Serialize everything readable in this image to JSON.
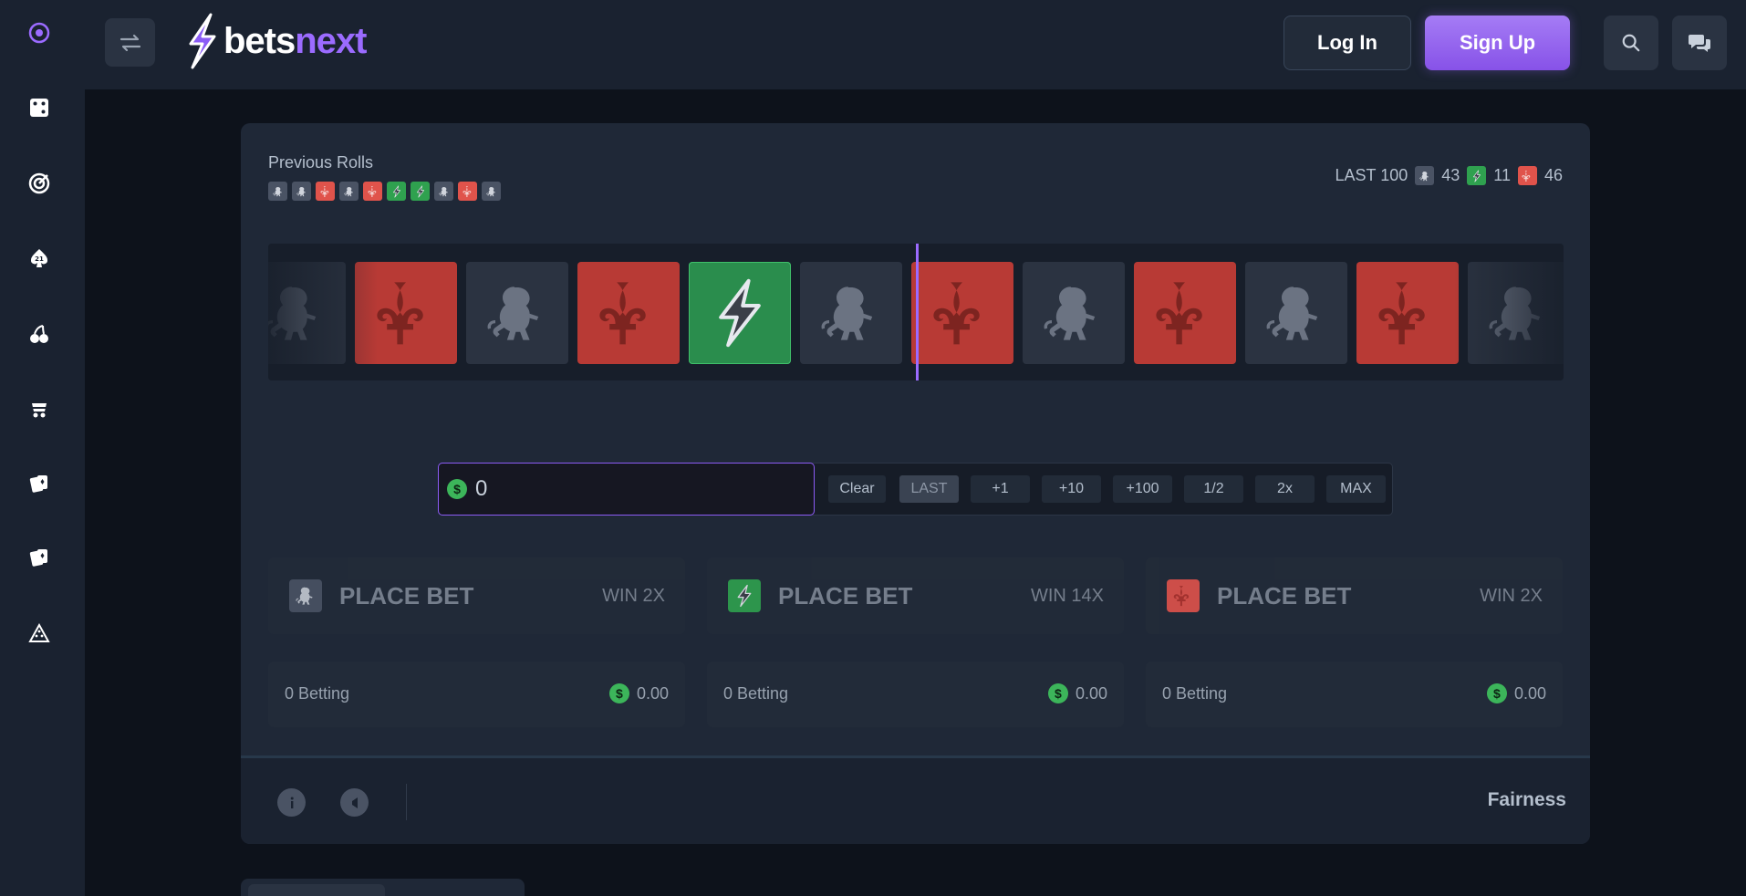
{
  "brand": {
    "bets": "bets",
    "next": "next"
  },
  "header": {
    "login": "Log In",
    "signup": "Sign Up"
  },
  "sidebar": {
    "items": [
      "home-icon",
      "dice-icon",
      "target-icon",
      "blackjack-icon",
      "cherries-icon",
      "mines-cart-icon",
      "cards-icon",
      "cards-alt-icon",
      "plinko-icon"
    ]
  },
  "game": {
    "previous_rolls_title": "Previous Rolls",
    "previous_rolls": [
      "lion",
      "lion",
      "fleur",
      "lion",
      "fleur",
      "bolt",
      "bolt",
      "lion",
      "fleur",
      "lion"
    ],
    "last100": {
      "label": "LAST 100",
      "lion": "43",
      "bolt": "11",
      "fleur": "46"
    },
    "strip": [
      "lion",
      "fleur",
      "lion",
      "fleur",
      "bolt",
      "lion",
      "fleur",
      "lion",
      "fleur",
      "lion",
      "fleur",
      "lion"
    ]
  },
  "bet": {
    "amount": "0",
    "currency_symbol": "$",
    "buttons": [
      "Clear",
      "LAST",
      "+1",
      "+10",
      "+100",
      "1/2",
      "2x",
      "MAX"
    ]
  },
  "cards": [
    {
      "label": "PLACE BET",
      "win": "WIN 2X",
      "icon": "lion",
      "betting": "0 Betting",
      "amount": "0.00"
    },
    {
      "label": "PLACE BET",
      "win": "WIN 14X",
      "icon": "bolt",
      "betting": "0 Betting",
      "amount": "0.00"
    },
    {
      "label": "PLACE BET",
      "win": "WIN 2X",
      "icon": "fleur",
      "betting": "0 Betting",
      "amount": "0.00"
    }
  ],
  "footer": {
    "fairness": "Fairness"
  },
  "colors": {
    "accent": "#9b6bff",
    "red": "#e0534b",
    "green": "#2fa14f",
    "grey": "#4a5364"
  }
}
